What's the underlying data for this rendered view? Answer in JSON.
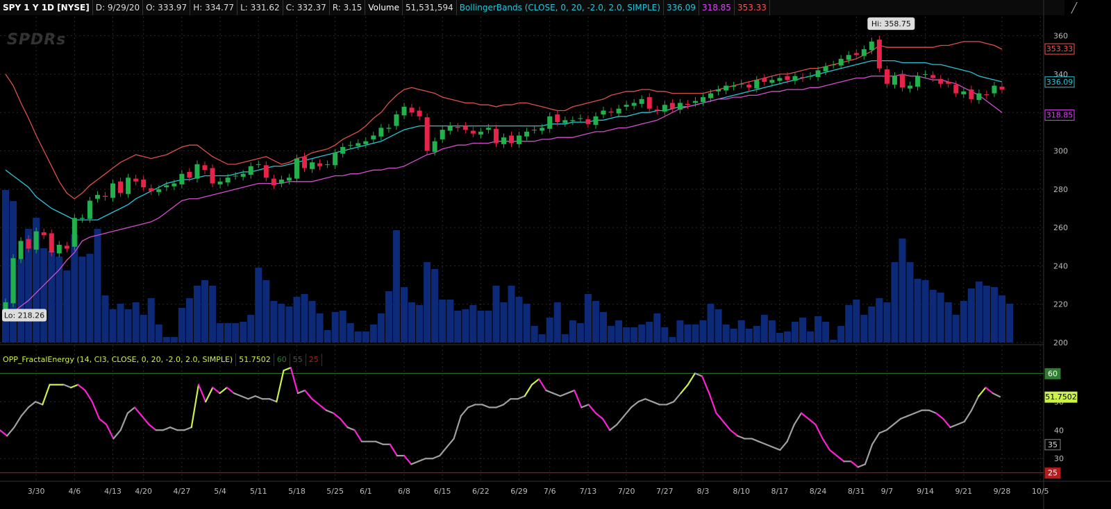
{
  "header": {
    "symbol": "SPY 1 Y 1D [NYSE]",
    "date": "D: 9/29/20",
    "open": "O: 333.97",
    "high": "H: 334.77",
    "low": "L: 331.62",
    "close": "C: 332.37",
    "range": "R: 3.15",
    "volume_label": "Volume",
    "volume_value": "51,531,594",
    "bb_label": "BollingerBands (CLOSE, 0, 20, -2.0, 2.0, SIMPLE)",
    "bb_mid": "336.09",
    "bb_lower": "318.85",
    "bb_upper": "353.33"
  },
  "logo": "SPDRs",
  "price_axis": {
    "ticks": [
      "360",
      "340",
      "320",
      "300",
      "280",
      "260",
      "240",
      "220",
      "200"
    ],
    "tick_values": [
      360,
      340,
      320,
      300,
      280,
      260,
      240,
      220,
      200
    ],
    "badges": [
      {
        "value": 353.33,
        "label": "353.33",
        "color": "#ff5252"
      },
      {
        "value": 336.09,
        "label": "336.09",
        "color": "#26c6da"
      },
      {
        "value": 318.85,
        "label": "318.85",
        "color": "#e040fb"
      }
    ]
  },
  "annotations": {
    "hi": "Hi: 358.75",
    "lo": "Lo: 218.26"
  },
  "indicator": {
    "label": "OPP_FractalEnergy (14, CI3, CLOSE, 0, 20, -2.0, 2.0, SIMPLE)",
    "value": "51.7502",
    "level_high": "60",
    "level_mid": "55",
    "level_low": "25",
    "axis_ticks": [
      "50",
      "40",
      "30"
    ],
    "axis_values": [
      50,
      40,
      30
    ],
    "badges": [
      {
        "value": 60,
        "label": "60",
        "color": "#2e7d32"
      },
      {
        "value": 51.75,
        "label": "51.7502",
        "color": "#ccf24a"
      },
      {
        "value": 35,
        "label": "35",
        "color": "#222"
      },
      {
        "value": 25,
        "label": "25",
        "color": "#b71c1c"
      }
    ]
  },
  "x_axis": {
    "labels": [
      "3/30",
      "4/6",
      "4/13",
      "4/20",
      "4/27",
      "5/4",
      "5/11",
      "5/18",
      "5/25",
      "6/1",
      "6/8",
      "6/15",
      "6/22",
      "6/29",
      "7/6",
      "7/13",
      "7/20",
      "7/27",
      "8/3",
      "8/10",
      "8/17",
      "8/24",
      "8/31",
      "9/7",
      "9/14",
      "9/21",
      "9/28",
      "10/5"
    ]
  },
  "colors": {
    "up": "#22b14c",
    "down": "#e8234a",
    "volume": "#0d2a78",
    "bb_upper": "#e0504a",
    "bb_mid": "#26c6da",
    "bb_lower": "#d64dd0",
    "fe_grey": "#a0a0a0",
    "fe_magenta": "#ff1fd6",
    "fe_yellow": "#ccf24a"
  },
  "chart_data": {
    "type": "candlestick",
    "x": [
      "3/24",
      "3/25",
      "3/26",
      "3/27",
      "3/30",
      "3/31",
      "4/1",
      "4/2",
      "4/3",
      "4/6",
      "4/7",
      "4/8",
      "4/9",
      "4/13",
      "4/14",
      "4/15",
      "4/16",
      "4/17",
      "4/20",
      "4/21",
      "4/22",
      "4/23",
      "4/24",
      "4/27",
      "4/28",
      "4/29",
      "4/30",
      "5/1",
      "5/4",
      "5/5",
      "5/6",
      "5/7",
      "5/8",
      "5/11",
      "5/12",
      "5/13",
      "5/14",
      "5/15",
      "5/18",
      "5/19",
      "5/20",
      "5/21",
      "5/22",
      "5/26",
      "5/27",
      "5/28",
      "5/29",
      "6/1",
      "6/2",
      "6/3",
      "6/4",
      "6/5",
      "6/8",
      "6/9",
      "6/10",
      "6/11",
      "6/12",
      "6/15",
      "6/16",
      "6/17",
      "6/18",
      "6/19",
      "6/22",
      "6/23",
      "6/24",
      "6/25",
      "6/26",
      "6/29",
      "6/30",
      "7/1",
      "7/2",
      "7/6",
      "7/7",
      "7/8",
      "7/9",
      "7/10",
      "7/13",
      "7/14",
      "7/15",
      "7/16",
      "7/17",
      "7/20",
      "7/21",
      "7/22",
      "7/23",
      "7/24",
      "7/27",
      "7/28",
      "7/29",
      "7/30",
      "7/31",
      "8/3",
      "8/4",
      "8/5",
      "8/6",
      "8/7",
      "8/10",
      "8/11",
      "8/12",
      "8/13",
      "8/14",
      "8/17",
      "8/18",
      "8/19",
      "8/20",
      "8/21",
      "8/24",
      "8/25",
      "8/26",
      "8/27",
      "8/28",
      "8/31",
      "9/1",
      "9/2",
      "9/3",
      "9/4",
      "9/8",
      "9/9",
      "9/10",
      "9/11",
      "9/14",
      "9/15",
      "9/16",
      "9/17",
      "9/18",
      "9/21",
      "9/22",
      "9/23",
      "9/24",
      "9/25",
      "9/28",
      "9/29"
    ],
    "close": [
      221,
      244,
      253,
      249,
      258,
      256,
      247,
      251,
      249,
      265,
      265,
      274,
      277,
      276,
      283,
      278,
      286,
      284,
      281,
      279,
      280,
      282,
      283,
      288,
      286,
      293,
      290,
      283,
      284,
      286,
      287,
      288,
      292,
      293,
      286,
      282,
      285,
      286,
      296,
      291,
      294,
      292,
      293,
      299,
      302,
      303,
      304,
      305,
      308,
      312,
      312,
      319,
      323,
      320,
      318,
      300,
      305,
      311,
      313,
      312,
      311,
      309,
      310,
      312,
      304,
      307,
      304,
      308,
      310,
      311,
      312,
      318,
      315,
      316,
      316,
      317,
      314,
      318,
      321,
      320,
      322,
      324,
      325,
      327,
      322,
      321,
      324,
      322,
      325,
      324,
      326,
      328,
      330,
      332,
      334,
      334,
      335,
      333,
      337,
      336,
      337,
      338,
      337,
      339,
      338,
      339,
      342,
      344,
      345,
      348,
      350,
      350,
      353,
      357,
      343,
      335,
      339,
      333,
      334,
      339,
      340,
      338,
      335,
      335,
      330,
      331,
      327,
      330,
      329,
      334,
      332
    ],
    "high_marker": 358.75,
    "low_marker": 218.26,
    "volume": [
      290,
      282,
      240,
      262,
      270,
      248,
      246,
      242,
      232,
      258,
      242,
      244,
      262,
      214,
      204,
      208,
      204,
      209,
      200,
      212,
      193,
      184,
      184,
      205,
      212,
      221,
      225,
      221,
      194,
      194,
      194,
      195,
      200,
      234,
      225,
      210,
      208,
      206,
      213,
      215,
      210,
      201,
      189,
      202,
      203,
      194,
      188,
      188,
      193,
      201,
      217,
      261,
      220,
      209,
      207,
      238,
      233,
      211,
      211,
      203,
      204,
      207,
      203,
      203,
      221,
      209,
      221,
      213,
      208,
      192,
      186,
      198,
      209,
      186,
      196,
      194,
      215,
      210,
      202,
      192,
      196,
      191,
      191,
      193,
      195,
      201,
      191,
      184,
      196,
      193,
      193,
      196,
      208,
      204,
      193,
      190,
      196,
      190,
      192,
      200,
      196,
      187,
      188,
      195,
      198,
      188,
      199,
      195,
      182,
      192,
      207,
      211,
      200,
      206,
      212,
      209,
      238,
      255,
      238,
      226,
      225,
      218,
      216,
      209,
      200,
      210,
      219,
      224,
      221,
      220,
      214,
      208
    ],
    "bb_upper": [
      340,
      334,
      325,
      317,
      308,
      300,
      292,
      284,
      278,
      275,
      278,
      282,
      285,
      288,
      291,
      294,
      296,
      298,
      297,
      296,
      297,
      298,
      300,
      302,
      303,
      303,
      300,
      297,
      295,
      293,
      293,
      294,
      295,
      296,
      297,
      295,
      293,
      294,
      296,
      297,
      299,
      300,
      301,
      303,
      306,
      308,
      310,
      313,
      317,
      320,
      325,
      329,
      332,
      333,
      332,
      331,
      330,
      328,
      327,
      326,
      325,
      325,
      324,
      324,
      323,
      324,
      324,
      325,
      325,
      324,
      323,
      322,
      321,
      321,
      323,
      324,
      325,
      326,
      327,
      329,
      330,
      331,
      331,
      332,
      332,
      331,
      331,
      330,
      330,
      330,
      330,
      330,
      331,
      332,
      333,
      334,
      335,
      336,
      337,
      338,
      339,
      340,
      340,
      341,
      342,
      343,
      343,
      344,
      345,
      346,
      347,
      348,
      350,
      352,
      355,
      354,
      354,
      354,
      354,
      354,
      354,
      354,
      355,
      355,
      356,
      357,
      357,
      357,
      356,
      355,
      353
    ],
    "bb_mid": [
      290,
      287,
      284,
      281,
      276,
      273,
      270,
      268,
      266,
      264,
      264,
      264,
      264,
      266,
      268,
      270,
      272,
      275,
      277,
      279,
      281,
      283,
      284,
      285,
      285,
      286,
      287,
      287,
      287,
      287,
      288,
      289,
      289,
      290,
      291,
      292,
      292,
      293,
      294,
      295,
      296,
      297,
      298,
      299,
      300,
      301,
      302,
      303,
      304,
      305,
      307,
      309,
      311,
      312,
      313,
      313,
      313,
      313,
      313,
      313,
      313,
      313,
      313,
      313,
      313,
      313,
      313,
      313,
      313,
      313,
      313,
      314,
      314,
      314,
      315,
      315,
      315,
      316,
      316,
      317,
      318,
      318,
      319,
      320,
      320,
      321,
      321,
      322,
      323,
      323,
      324,
      325,
      326,
      327,
      328,
      329,
      330,
      331,
      332,
      333,
      334,
      335,
      336,
      337,
      338,
      339,
      340,
      341,
      342,
      343,
      344,
      345,
      346,
      347,
      347,
      347,
      347,
      346,
      346,
      346,
      346,
      345,
      345,
      344,
      343,
      342,
      341,
      339,
      338,
      337,
      336
    ],
    "bb_lower": [
      214,
      216,
      219,
      222,
      226,
      230,
      234,
      238,
      243,
      247,
      253,
      255,
      256,
      257,
      258,
      259,
      260,
      261,
      262,
      263,
      265,
      268,
      271,
      274,
      275,
      275,
      276,
      277,
      278,
      279,
      280,
      281,
      282,
      283,
      283,
      283,
      283,
      284,
      284,
      284,
      284,
      285,
      286,
      287,
      287,
      288,
      288,
      289,
      290,
      290,
      291,
      291,
      292,
      294,
      296,
      298,
      299,
      301,
      302,
      303,
      303,
      304,
      304,
      304,
      305,
      305,
      305,
      305,
      305,
      305,
      306,
      306,
      307,
      307,
      307,
      308,
      309,
      310,
      310,
      311,
      312,
      312,
      313,
      314,
      315,
      316,
      318,
      320,
      322,
      323,
      324,
      325,
      326,
      327,
      327,
      328,
      328,
      329,
      329,
      330,
      331,
      331,
      332,
      332,
      332,
      333,
      333,
      334,
      335,
      336,
      337,
      338,
      338,
      339,
      339,
      339,
      339,
      340,
      339,
      339,
      338,
      337,
      337,
      336,
      335,
      333,
      331,
      329,
      326,
      323,
      320
    ],
    "fractal_energy": [
      40,
      38,
      41,
      45,
      48,
      50,
      49,
      56,
      56,
      56,
      55,
      56,
      54,
      50,
      44,
      42,
      37,
      40,
      46,
      48,
      45,
      42,
      40,
      40,
      41,
      40,
      40,
      41,
      56,
      50,
      55,
      53,
      55,
      53,
      52,
      51,
      52,
      51,
      51,
      50,
      61,
      62,
      53,
      54,
      51,
      49,
      47,
      46,
      44,
      41,
      40,
      36,
      36,
      36,
      35,
      35,
      31,
      31,
      28,
      29,
      30,
      30,
      31,
      34,
      37,
      45,
      48,
      49,
      49,
      48,
      48,
      49,
      51,
      51,
      52,
      56,
      58,
      54,
      53,
      52,
      53,
      54,
      48,
      49,
      46,
      44,
      40,
      42,
      45,
      48,
      50,
      51,
      50,
      49,
      49,
      50,
      53,
      56,
      60,
      59,
      53,
      46,
      43,
      40,
      38,
      37,
      37,
      36,
      35,
      34,
      33,
      36,
      42,
      46,
      44,
      42,
      37,
      33,
      31,
      29,
      29,
      27,
      28,
      35,
      39,
      40,
      42,
      44,
      45,
      46,
      47,
      47,
      46,
      44,
      41,
      42,
      43,
      47,
      52,
      55,
      53,
      51.75
    ],
    "fe_color": [],
    "ylim_price": [
      200,
      370
    ],
    "ylim_fe": [
      22,
      64
    ]
  }
}
